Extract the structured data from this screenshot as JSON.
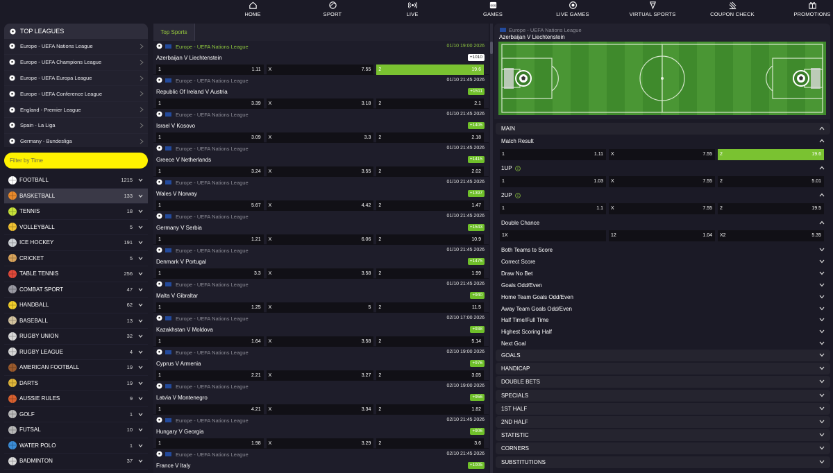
{
  "nav": [
    {
      "id": "home",
      "label": "HOME",
      "icon": "home-icon"
    },
    {
      "id": "sport",
      "label": "SPORT",
      "icon": "sport-icon"
    },
    {
      "id": "live",
      "label": "LIVE",
      "icon": "live-icon"
    },
    {
      "id": "games",
      "label": "GAMES",
      "icon": "games-icon"
    },
    {
      "id": "live-games",
      "label": "LIVE GAMES",
      "icon": "live-games-icon"
    },
    {
      "id": "virtual-sports",
      "label": "VIRTUAL SPORTS",
      "icon": "virtual-sports-icon"
    },
    {
      "id": "coupon-check",
      "label": "COUPON CHECK",
      "icon": "coupon-check-icon"
    },
    {
      "id": "promotions",
      "label": "PROMOTIONS",
      "icon": "gift-icon"
    }
  ],
  "leagues": {
    "title": "TOP LEAGUES",
    "items": [
      "Europe - UEFA Nations League",
      "Europe - UEFA Champions League",
      "Europe - UEFA Europa League",
      "Europe - UEFA Conference League",
      "England - Premier League",
      "Spain - La Liga",
      "Germany - Bundesliga"
    ]
  },
  "filter": {
    "placeholder": "Filter by Time"
  },
  "sports": [
    {
      "name": "FOOTBALL",
      "count": "1215",
      "color": "#ffffff"
    },
    {
      "name": "BASKETBALL",
      "count": "133",
      "color": "#e8892b"
    },
    {
      "name": "TENNIS",
      "count": "18",
      "color": "#c7e23a"
    },
    {
      "name": "VOLLEYBALL",
      "count": "5",
      "color": "#f1c232"
    },
    {
      "name": "ICE HOCKEY",
      "count": "191",
      "color": "#cfd3d6"
    },
    {
      "name": "CRICKET",
      "count": "5",
      "color": "#d9a45b"
    },
    {
      "name": "TABLE TENNIS",
      "count": "256",
      "color": "#e24a3b"
    },
    {
      "name": "COMBAT SPORT",
      "count": "47",
      "color": "#9a9aa3"
    },
    {
      "name": "HANDBALL",
      "count": "62",
      "color": "#f2cf2c"
    },
    {
      "name": "BASEBALL",
      "count": "13",
      "color": "#d3c3a0"
    },
    {
      "name": "RUGBY UNION",
      "count": "32",
      "color": "#d8d8d8"
    },
    {
      "name": "RUGBY LEAGUE",
      "count": "4",
      "color": "#d8d8d8"
    },
    {
      "name": "AMERICAN FOOTBALL",
      "count": "19",
      "color": "#9a5a2c"
    },
    {
      "name": "DARTS",
      "count": "19",
      "color": "#e0b63a"
    },
    {
      "name": "AUSSIE RULES",
      "count": "9",
      "color": "#d8612f"
    },
    {
      "name": "GOLF",
      "count": "1",
      "color": "#bcbcbc"
    },
    {
      "name": "FUTSAL",
      "count": "10",
      "color": "#b8b8b8"
    },
    {
      "name": "WATER POLO",
      "count": "1",
      "color": "#3b8ed8"
    },
    {
      "name": "BADMINTON",
      "count": "37",
      "color": "#dcdcdc"
    }
  ],
  "center": {
    "tab": "Top Sports",
    "matches": [
      {
        "league": "Europe - UEFA Nations League",
        "datetime": "01/10 19:00 2026",
        "teams": "Azerbaijan V Liechtenstein",
        "markets": "+1010",
        "o1": "1.11",
        "ox": "7.55",
        "o2": "19.6",
        "selected": true
      },
      {
        "league": "Europe - UEFA Nations League",
        "datetime": "01/10 21:45 2026",
        "teams": "Republic Of Ireland V Austria",
        "markets": "+1511",
        "o1": "3.39",
        "ox": "3.18",
        "o2": "2.1"
      },
      {
        "league": "Europe - UEFA Nations League",
        "datetime": "01/10 21:45 2026",
        "teams": "Israel V Kosovo",
        "markets": "+1405",
        "o1": "3.09",
        "ox": "3.3",
        "o2": "2.18"
      },
      {
        "league": "Europe - UEFA Nations League",
        "datetime": "01/10 21:45 2026",
        "teams": "Greece V Netherlands",
        "markets": "+1415",
        "o1": "3.24",
        "ox": "3.55",
        "o2": "2.02"
      },
      {
        "league": "Europe - UEFA Nations League",
        "datetime": "01/10 21:45 2026",
        "teams": "Wales V Norway",
        "markets": "+1397",
        "o1": "5.67",
        "ox": "4.42",
        "o2": "1.47"
      },
      {
        "league": "Europe - UEFA Nations League",
        "datetime": "01/10 21:45 2026",
        "teams": "Germany V Serbia",
        "markets": "+1543",
        "o1": "1.21",
        "ox": "6.06",
        "o2": "10.9"
      },
      {
        "league": "Europe - UEFA Nations League",
        "datetime": "01/10 21:45 2026",
        "teams": "Denmark V Portugal",
        "markets": "+1475",
        "o1": "3.3",
        "ox": "3.58",
        "o2": "1.99"
      },
      {
        "league": "Europe - UEFA Nations League",
        "datetime": "01/10 21:45 2026",
        "teams": "Malta V Gibraltar",
        "markets": "+940",
        "o1": "1.25",
        "ox": "5",
        "o2": "11.5"
      },
      {
        "league": "Europe - UEFA Nations League",
        "datetime": "02/10 17:00 2026",
        "teams": "Kazakhstan V Moldova",
        "markets": "+938",
        "o1": "1.64",
        "ox": "3.58",
        "o2": "5.14"
      },
      {
        "league": "Europe - UEFA Nations League",
        "datetime": "02/10 19:00 2026",
        "teams": "Cyprus V Armenia",
        "markets": "+976",
        "o1": "2.21",
        "ox": "3.27",
        "o2": "3.05"
      },
      {
        "league": "Europe - UEFA Nations League",
        "datetime": "02/10 19:00 2026",
        "teams": "Latvia V Montenegro",
        "markets": "+956",
        "o1": "4.21",
        "ox": "3.34",
        "o2": "1.82"
      },
      {
        "league": "Europe - UEFA Nations League",
        "datetime": "02/10 21:45 2026",
        "teams": "Hungary V Georgia",
        "markets": "+906",
        "o1": "1.98",
        "ox": "3.29",
        "o2": "3.6"
      },
      {
        "league": "Europe - UEFA Nations League",
        "datetime": "02/10 21:45 2026",
        "teams": "France V Italy",
        "markets": "+1005",
        "o1": "",
        "ox": "",
        "o2": ""
      }
    ]
  },
  "detail": {
    "league": "Europe - UEFA Nations League",
    "teams": "Azerbaijan V Liechtenstein",
    "main": "MAIN",
    "match_result": {
      "label": "Match Result",
      "o1": "1.11",
      "ox": "7.55",
      "o2": "19.6"
    },
    "up1": {
      "label": "1UP",
      "o1": "1.03",
      "ox": "7.55",
      "o2": "5.01"
    },
    "up2": {
      "label": "2UP",
      "o1": "1.1",
      "ox": "7.55",
      "o2": "19.5"
    },
    "double_chance": {
      "label": "Double Chance",
      "a": "1X",
      "b": "12",
      "bv": "1.04",
      "c": "X2",
      "cv": "5.35"
    },
    "sub_markets": [
      "Both Teams to Score",
      "Correct Score",
      "Draw No Bet",
      "Goals Odd/Even",
      "Home Team Goals Odd/Even",
      "Away Team Goals Odd/Even",
      "Half Time/Full Time",
      "Highest Scoring Half",
      "Next Goal"
    ],
    "sections": [
      "GOALS",
      "HANDICAP",
      "DOUBLE BETS",
      "SPECIALS",
      "1ST HALF",
      "2ND HALF",
      "STATISTIC",
      "CORNERS",
      "SUBSTITUTIONS"
    ]
  },
  "odds_labels": {
    "one": "1",
    "x": "X",
    "two": "2"
  },
  "colors": {
    "accent_green": "#7ac231",
    "filter_yellow": "#fff200",
    "bg": "#1b1a26"
  }
}
